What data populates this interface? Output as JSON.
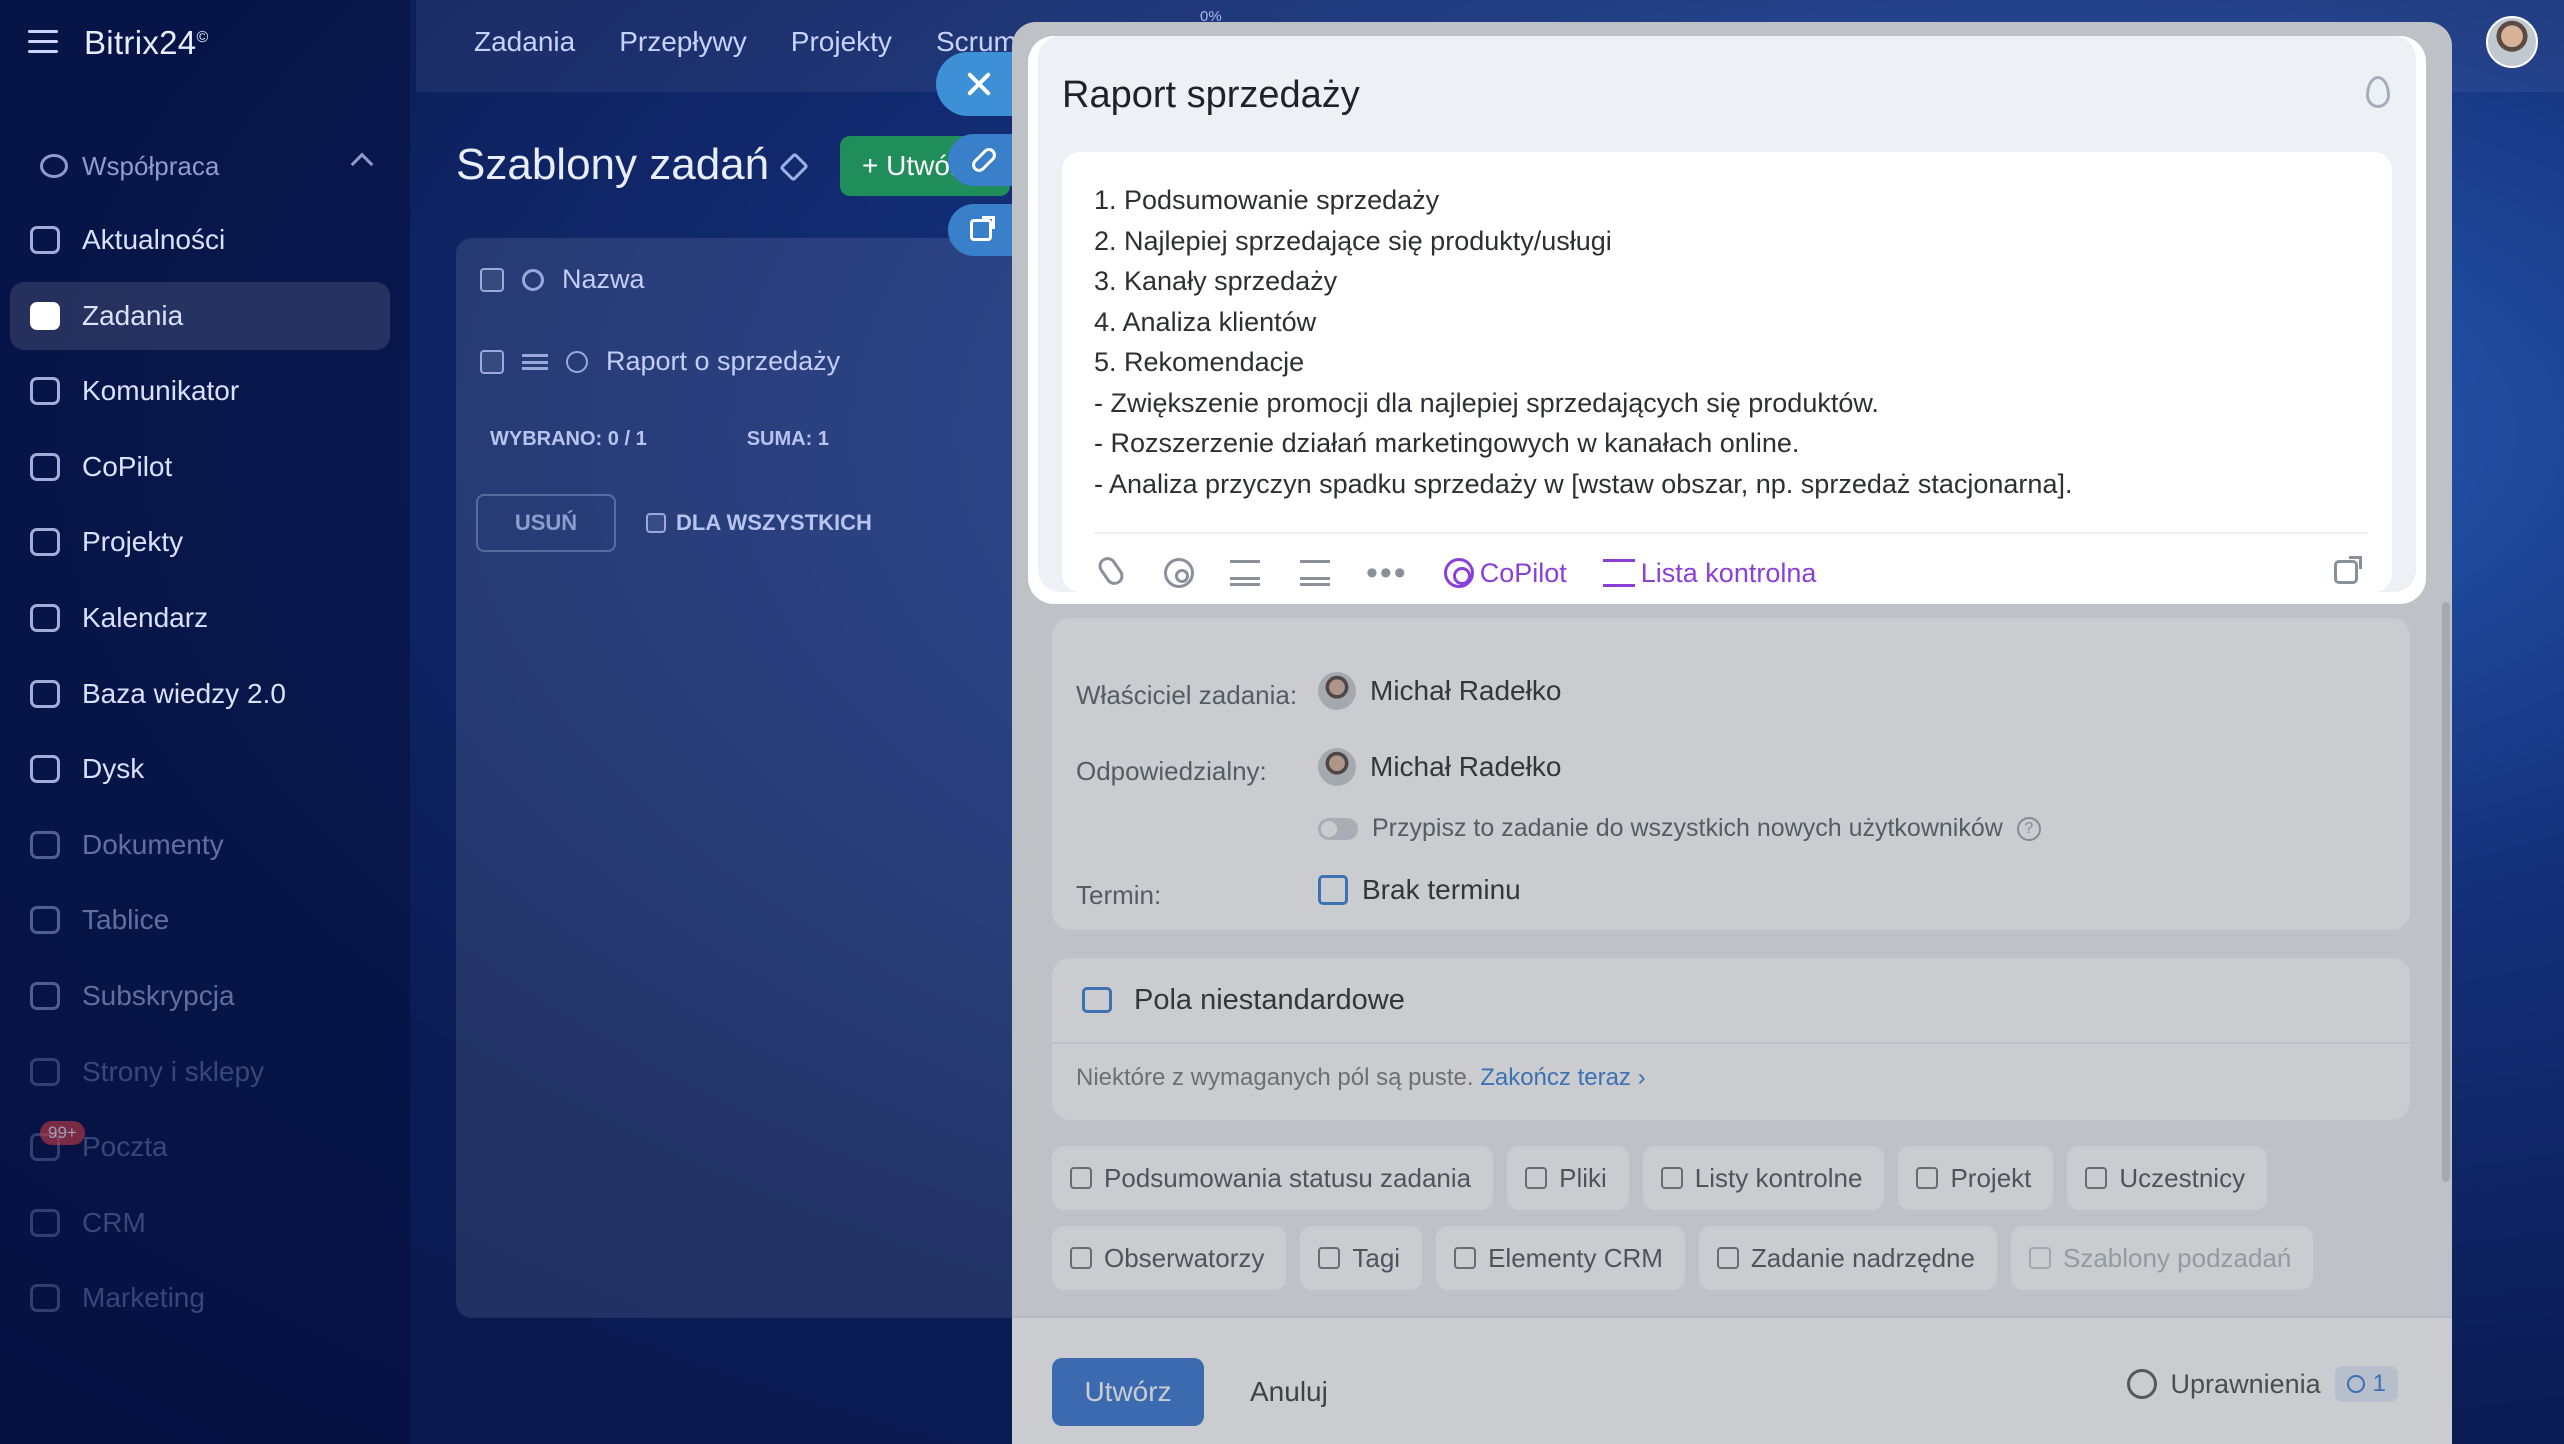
{
  "app": {
    "brand": "Bitrix24",
    "brand_mark": "©"
  },
  "topbar": {
    "nav": [
      "Zadania",
      "Przepływy",
      "Projekty",
      "Scrum"
    ],
    "progress_text": "0%"
  },
  "sidebar": {
    "group_label": "Współpraca",
    "items": [
      {
        "label": "Aktualności",
        "icon": "news-icon"
      },
      {
        "label": "Zadania",
        "icon": "tasks-icon"
      },
      {
        "label": "Komunikator",
        "icon": "chat-icon"
      },
      {
        "label": "CoPilot",
        "icon": "copilot-icon"
      },
      {
        "label": "Projekty",
        "icon": "projects-icon"
      },
      {
        "label": "Kalendarz",
        "icon": "calendar-icon"
      },
      {
        "label": "Baza wiedzy 2.0",
        "icon": "knowledge-icon"
      },
      {
        "label": "Dysk",
        "icon": "drive-icon"
      },
      {
        "label": "Dokumenty",
        "icon": "documents-icon"
      },
      {
        "label": "Tablice",
        "icon": "boards-icon"
      },
      {
        "label": "Subskrypcja",
        "icon": "subscription-icon"
      },
      {
        "label": "Strony i sklepy",
        "icon": "sites-icon"
      },
      {
        "label": "Poczta",
        "icon": "mail-icon"
      },
      {
        "label": "CRM",
        "icon": "crm-icon"
      },
      {
        "label": "Marketing",
        "icon": "marketing-icon"
      }
    ],
    "mail_badge": "99+"
  },
  "page": {
    "title": "Szablony zadań",
    "create_button": "Utwórz",
    "grid": {
      "column_header": "Nazwa",
      "row_label": "Raport o sprzedaży",
      "selected_label": "WYBRANO:",
      "selected_value": "0 / 1",
      "sum_label": "SUMA:",
      "sum_value": "1",
      "delete_button": "USUŃ",
      "for_all_label": "DLA WSZYSTKICH"
    }
  },
  "modal": {
    "title": "Raport sprzedaży",
    "description_lines": [
      "1. Podsumowanie sprzedaży",
      "2. Najlepiej sprzedające się produkty/usługi",
      "3. Kanały sprzedaży",
      "4. Analiza klientów",
      "5. Rekomendacje",
      "- Zwiększenie promocji dla najlepiej sprzedających się produktów.",
      "- Rozszerzenie działań marketingowych w kanałach online.",
      "- Analiza przyczyn spadku sprzedaży w [wstaw obszar, np. sprzedaż stacjonarna]."
    ],
    "toolbar": {
      "copilot": "CoPilot",
      "checklist": "Lista kontrolna"
    },
    "fields": {
      "owner_label": "Właściciel zadania:",
      "owner_name": "Michał Radełko",
      "responsible_label": "Odpowiedzialny:",
      "responsible_name": "Michał Radełko",
      "assign_all_text": "Przypisz to zadanie do wszystkich nowych użytkowników",
      "deadline_label": "Termin:",
      "deadline_value": "Brak terminu"
    },
    "custom_fields": {
      "title": "Pola niestandardowe",
      "note": "Niektóre z wymaganych pól są puste.",
      "note_link": "Zakończ teraz"
    },
    "chips_row1": [
      "Podsumowania statusu zadania",
      "Pliki",
      "Listy kontrolne",
      "Projekt",
      "Uczestnicy"
    ],
    "chips_row2": [
      "Obserwatorzy",
      "Tagi",
      "Elementy CRM",
      "Zadanie nadrzędne",
      "Szablony podzadań"
    ],
    "footer": {
      "create": "Utwórz",
      "cancel": "Anuluj",
      "permissions": "Uprawnienia",
      "permissions_count": "1"
    }
  },
  "colors": {
    "accent": "#2d6fd2",
    "copilot": "#8b3fd9",
    "success": "#1f8e5a"
  }
}
